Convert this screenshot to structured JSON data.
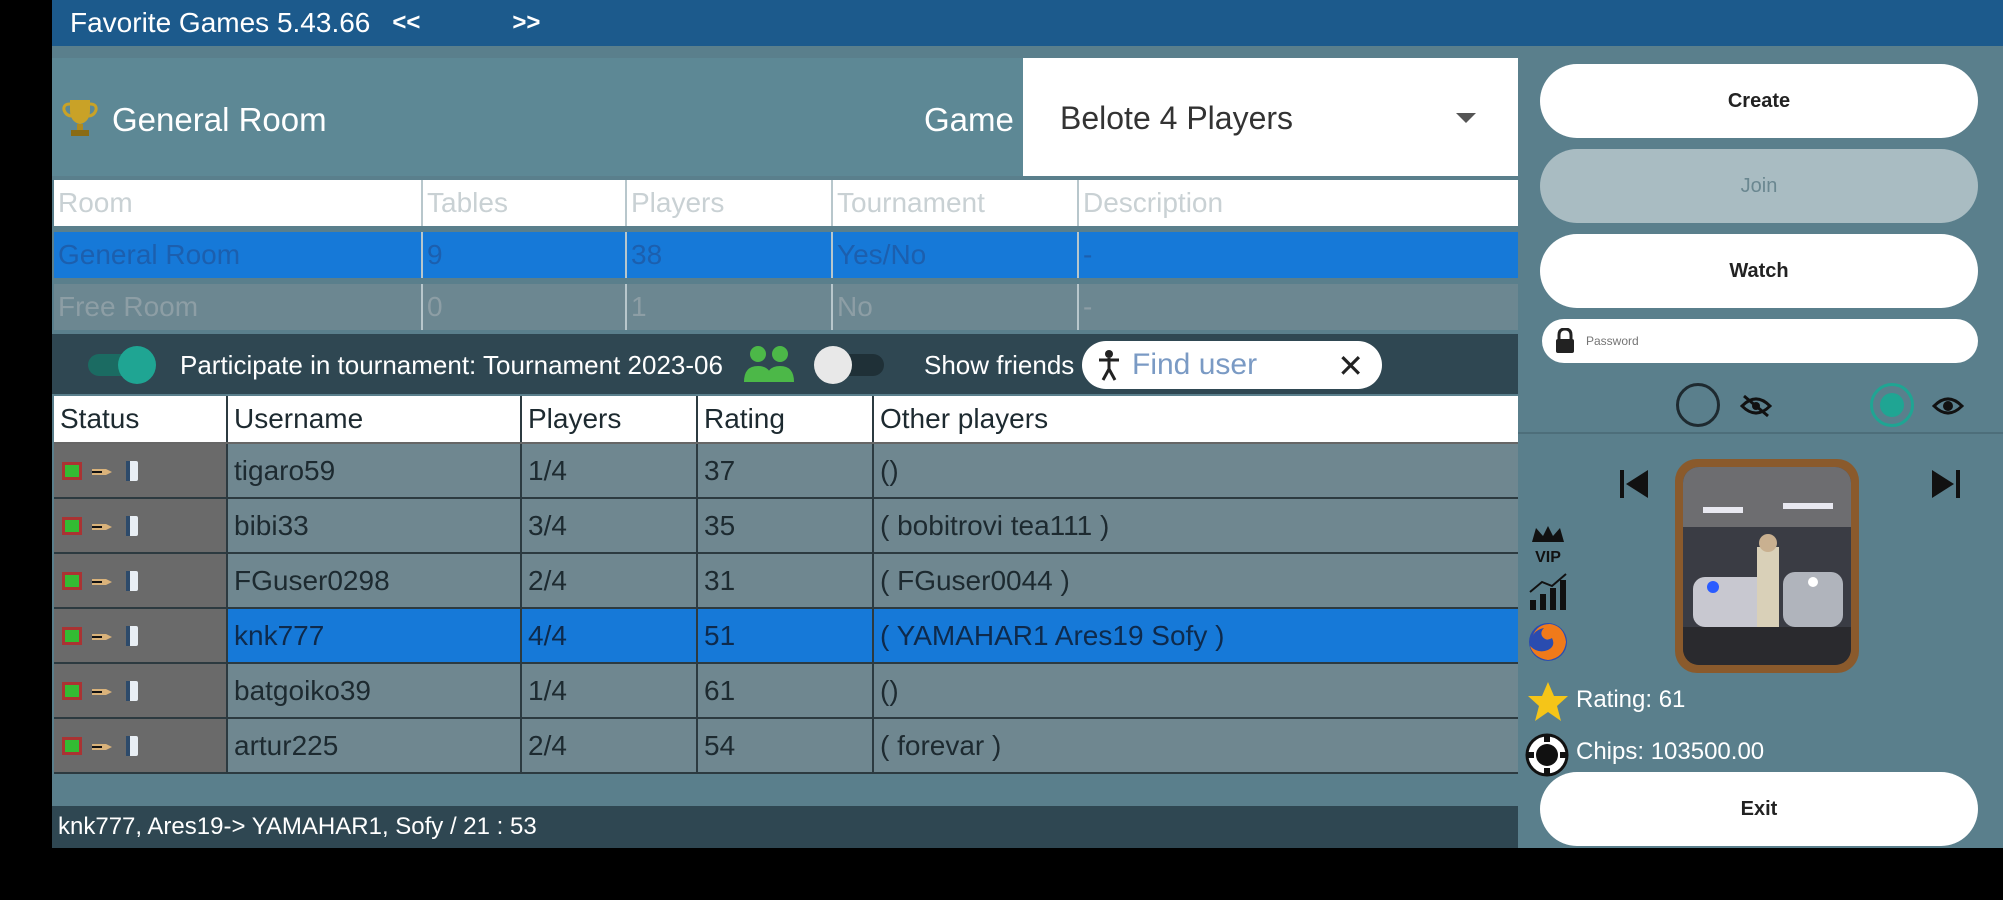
{
  "titlebar": {
    "title": "Favorite Games 5.43.66",
    "prev": "<<",
    "next": ">>"
  },
  "header": {
    "room_title": "General Room",
    "game_label": "Game",
    "game_value": "Belote 4 Players"
  },
  "rooms": {
    "columns": [
      "Room",
      "Tables",
      "Players",
      "Tournament",
      "Description"
    ],
    "rows": [
      [
        "General Room",
        "9",
        "38",
        "Yes/No",
        "-"
      ],
      [
        "Free Room",
        "0",
        "1",
        "No",
        "-"
      ]
    ]
  },
  "tournament_bar": {
    "participate_label": "Participate in tournament: Tournament 2023-06",
    "show_friends_label": "Show friends",
    "find_user_placeholder": "Find user",
    "clear": "✕"
  },
  "users": {
    "columns": [
      "Status",
      "Username",
      "Players",
      "Rating",
      "Other players"
    ],
    "rows": [
      [
        "tigaro59",
        "1/4",
        "37",
        "()"
      ],
      [
        "bibi33",
        "3/4",
        "35",
        "( bobitrovi  tea111 )"
      ],
      [
        "FGuser0298",
        "2/4",
        "31",
        "( FGuser0044 )"
      ],
      [
        "knk777",
        "4/4",
        "51",
        "( YAMAHAR1  Ares19  Sofy )"
      ],
      [
        "batgoiko39",
        "1/4",
        "61",
        "()"
      ],
      [
        "artur225",
        "2/4",
        "54",
        "( forevar )"
      ]
    ],
    "selected_row": 3
  },
  "status_bar": "knk777, Ares19-> YAMAHAR1, Sofy / 21 : 53",
  "right_panel": {
    "create": "Create",
    "join": "Join",
    "watch": "Watch",
    "password_placeholder": "Password",
    "rating": "Rating: 61",
    "chips": "Chips: 103500.00",
    "exit": "Exit",
    "vip": "VIP"
  },
  "colors": {
    "accent": "#1679d8",
    "titlebar": "#1c5a8c",
    "toggle_on": "#1fa593",
    "friends": "#4cb848"
  }
}
